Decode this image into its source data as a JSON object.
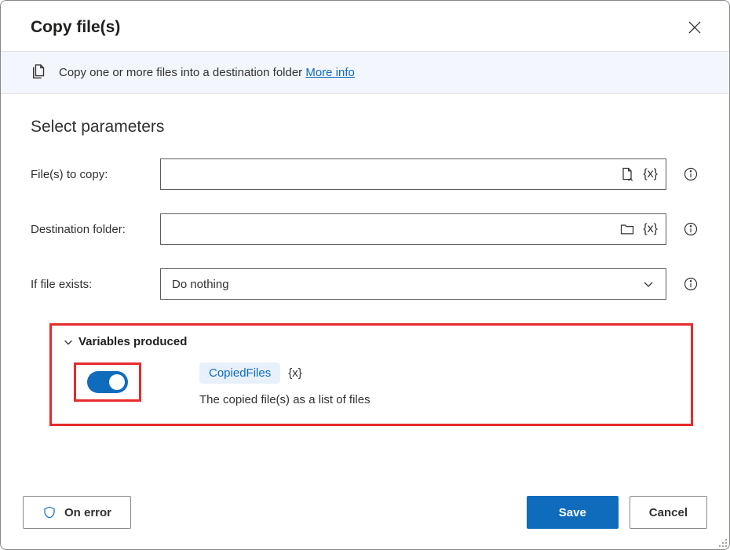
{
  "header": {
    "title": "Copy file(s)"
  },
  "banner": {
    "text": "Copy one or more files into a destination folder ",
    "link": "More info"
  },
  "section": {
    "title": "Select parameters"
  },
  "fields": {
    "files_label": "File(s) to copy:",
    "files_value": "",
    "destination_label": "Destination folder:",
    "destination_value": "",
    "exists_label": "If file exists:",
    "exists_value": "Do nothing"
  },
  "variables": {
    "header": "Variables produced",
    "name": "CopiedFiles",
    "syntax": "{x}",
    "description": "The copied file(s) as a list of files"
  },
  "footer": {
    "on_error": "On error",
    "save": "Save",
    "cancel": "Cancel"
  }
}
